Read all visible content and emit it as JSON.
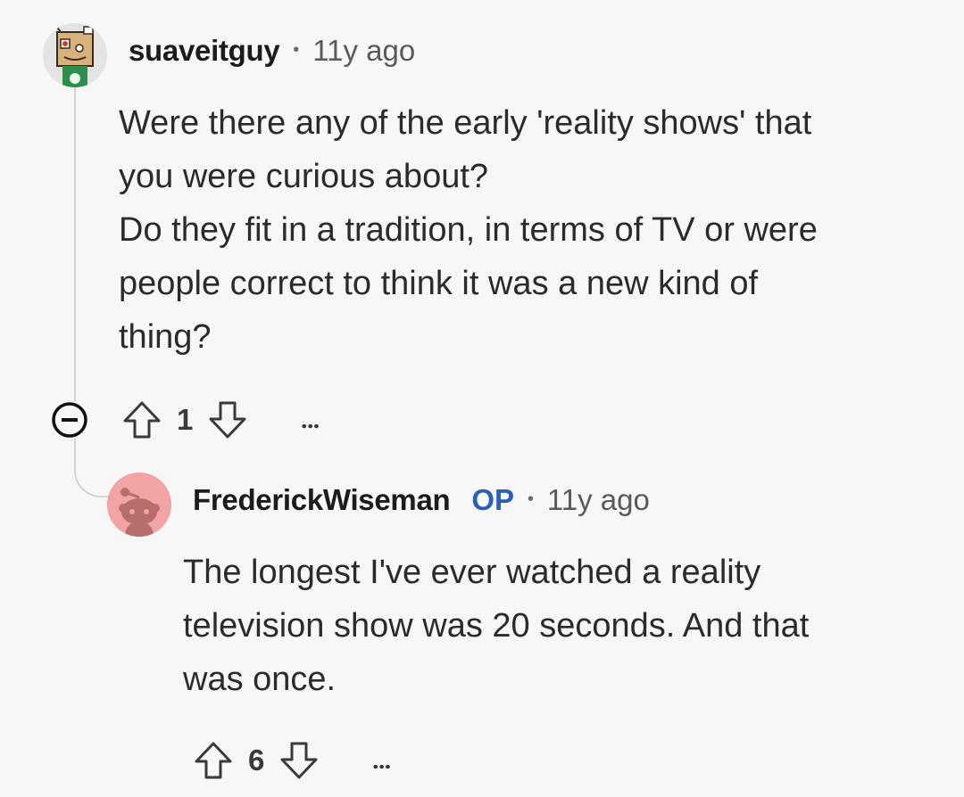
{
  "comments": [
    {
      "username": "suaveitguy",
      "age": "11y ago",
      "avatar_icon": "snoo-boxhead-avatar-icon",
      "body_lines": [
        "Were there any of the early 'reality shows' that",
        "you were curious about?",
        "Do they fit in a tradition, in terms of TV or were",
        "people correct to think it was a new kind of",
        "thing?"
      ],
      "score": "1",
      "more": "…"
    },
    {
      "username": "FrederickWiseman",
      "op_badge": "OP",
      "age": "11y ago",
      "avatar_icon": "default-snoo-avatar-icon",
      "body_lines": [
        "The longest I've ever watched a reality",
        "television show was 20 seconds. And that",
        "was once."
      ],
      "score": "6",
      "more": "…"
    }
  ],
  "separator": "•",
  "colors": {
    "background": "#f7f7f7",
    "op_badge": "#2b5fb3",
    "thread_line": "#d4d4d4",
    "avatar2_bg": "#f2a4a4"
  }
}
